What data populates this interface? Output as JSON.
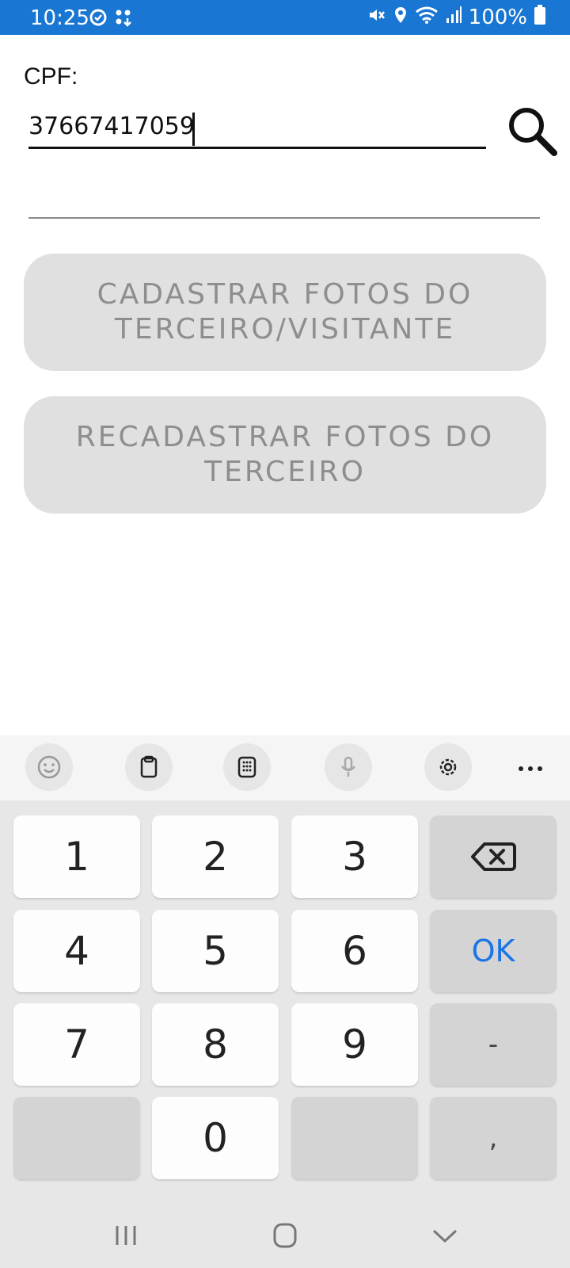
{
  "status_bar": {
    "time": "10:25",
    "battery_pct": "100%",
    "icons": [
      "sync-icon",
      "apps-icon",
      "mute-icon",
      "location-icon",
      "wifi-icon",
      "signal-icon",
      "battery-icon"
    ]
  },
  "form": {
    "cpf_label": "CPF:",
    "cpf_value": "37667417059",
    "second_field_value": ""
  },
  "buttons": {
    "register_photos": "CADASTRAR FOTOS DO TERCEIRO/VISITANTE",
    "reregister_photos": "RECADASTRAR FOTOS DO TERCEIRO"
  },
  "keyboard": {
    "toolbar": [
      "emoji-icon",
      "clipboard-icon",
      "keypad-icon",
      "mic-icon",
      "settings-icon",
      "more-icon"
    ],
    "keys": {
      "k1": "1",
      "k2": "2",
      "k3": "3",
      "k4": "4",
      "k5": "5",
      "k6": "6",
      "k7": "7",
      "k8": "8",
      "k9": "9",
      "k0": "0",
      "ok": "OK",
      "dash": "-",
      "comma": ","
    }
  },
  "colors": {
    "status_bar": "#1976d2",
    "button_bg": "#e0e0e0",
    "button_text": "#8e8e8e",
    "ok_key": "#1a73e8"
  }
}
